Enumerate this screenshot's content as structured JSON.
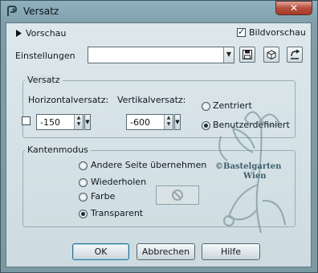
{
  "window": {
    "title": "Versatz",
    "close_label": "✕"
  },
  "preview": {
    "toggle_label": "Vorschau",
    "bildvorschau_label": "Bildvorschau",
    "bildvorschau_checked": true
  },
  "settings": {
    "label": "Einstellungen",
    "value": ""
  },
  "offset_group": {
    "title": "Versatz",
    "horizontal_label": "Horizontalversatz:",
    "horizontal_value": "-150",
    "vertical_label": "Vertikalversatz:",
    "vertical_value": "-600",
    "zentriert_label": "Zentriert",
    "benutzer_label": "Benutzerdefiniert",
    "selected": "Benutzerdefiniert"
  },
  "edge_group": {
    "title": "Kantenmodus",
    "options": [
      "Andere Seite übernehmen",
      "Wiederholen",
      "Farbe",
      "Transparent"
    ],
    "selected": "Transparent"
  },
  "watermark": {
    "line1": "©Bastelgarten",
    "line2": "Wien"
  },
  "buttons": {
    "ok": "OK",
    "cancel": "Abbrechen",
    "help": "Hilfe"
  }
}
